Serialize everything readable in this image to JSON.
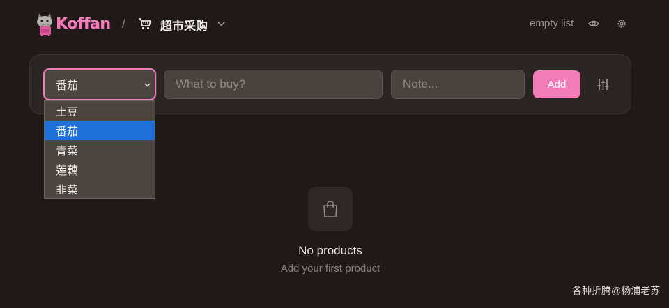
{
  "header": {
    "brand": "Koffan",
    "breadcrumb_separator": "/",
    "list_title": "超市采购",
    "empty_list_label": "empty list",
    "icons": [
      "cart-icon",
      "chevron-down-icon",
      "eye-icon",
      "gear-icon"
    ]
  },
  "form": {
    "selected_category": "番茄",
    "product_placeholder": "What to buy?",
    "note_placeholder": "Note...",
    "add_label": "Add",
    "filter_icon": "sliders-icon"
  },
  "dropdown": {
    "options": [
      "土豆",
      "番茄",
      "青菜",
      "莲藕",
      "韭菜"
    ],
    "selected_index": 1
  },
  "empty_state": {
    "icon": "shopping-bag-icon",
    "title": "No products",
    "subtitle": "Add your first product"
  },
  "watermark": "各种折腾@杨浦老苏",
  "colors": {
    "background": "#1f1a17",
    "card": "#2a2522",
    "accent": "#f27db9",
    "selected_option": "#1f6fd9"
  }
}
